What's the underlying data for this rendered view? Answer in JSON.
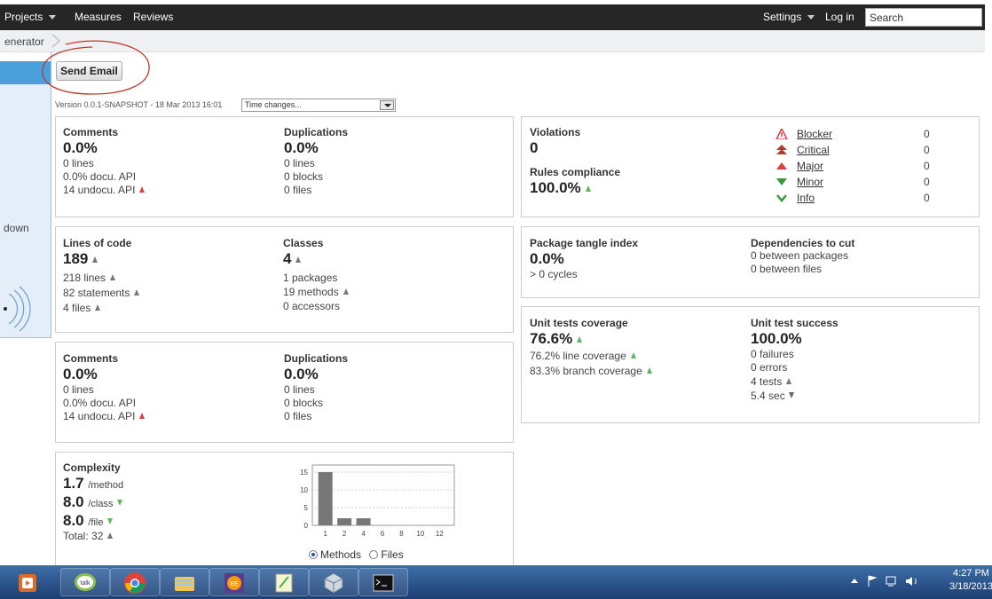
{
  "nav": {
    "projects": "Projects",
    "measures": "Measures",
    "reviews": "Reviews",
    "settings": "Settings",
    "login": "Log in",
    "search_value": "Search"
  },
  "breadcrumb": {
    "text": "enerator"
  },
  "sidebar": {
    "text": "down"
  },
  "toolbar": {
    "send_email": "Send Email",
    "version": "Version 0.0.1-SNAPSHOT - 18 Mar 2013 16:01",
    "time_changes": "Time changes..."
  },
  "comments1": {
    "label": "Comments",
    "value": "0.0%",
    "lines": "0 lines",
    "docu": "0.0% docu. API",
    "undocu": "14 undocu. API"
  },
  "duplications1": {
    "label": "Duplications",
    "value": "0.0%",
    "lines": "0 lines",
    "blocks": "0 blocks",
    "files": "0 files"
  },
  "violations": {
    "label": "Violations",
    "value": "0",
    "compliance_label": "Rules compliance",
    "compliance_value": "100.0%",
    "severities": [
      {
        "name": "Blocker",
        "count": "0"
      },
      {
        "name": "Critical",
        "count": "0"
      },
      {
        "name": "Major",
        "count": "0"
      },
      {
        "name": "Minor",
        "count": "0"
      },
      {
        "name": "Info",
        "count": "0"
      }
    ]
  },
  "size": {
    "loc_label": "Lines of code",
    "loc_value": "189",
    "lines": "218 lines",
    "statements": "82 statements",
    "files": "4 files",
    "classes_label": "Classes",
    "classes_value": "4",
    "packages": "1 packages",
    "methods": "19 methods",
    "accessors": "0 accessors"
  },
  "tangle": {
    "label": "Package tangle index",
    "value": "0.0%",
    "cycles": "> 0 cycles",
    "deps_label": "Dependencies to cut",
    "between_packages": "0 between packages",
    "between_files": "0 between files"
  },
  "comments2": {
    "label": "Comments",
    "value": "0.0%",
    "lines": "0 lines",
    "docu": "0.0% docu. API",
    "undocu": "14 undocu. API"
  },
  "duplications2": {
    "label": "Duplications",
    "value": "0.0%",
    "lines": "0 lines",
    "blocks": "0 blocks",
    "files": "0 files"
  },
  "tests": {
    "coverage_label": "Unit tests coverage",
    "coverage_value": "76.6%",
    "line_coverage": "76.2% line coverage",
    "branch_coverage": "83.3% branch coverage",
    "success_label": "Unit test success",
    "success_value": "100.0%",
    "failures": "0 failures",
    "errors": "0 errors",
    "tests": "4 tests",
    "duration": "5.4 sec"
  },
  "complexity": {
    "label": "Complexity",
    "per_method": "1.7",
    "per_method_unit": "/method",
    "per_class": "8.0",
    "per_class_unit": "/class",
    "per_file": "8.0",
    "per_file_unit": "/file",
    "total": "Total: 32",
    "radio_methods": "Methods",
    "radio_files": "Files"
  },
  "chart_data": {
    "type": "bar",
    "categories": [
      "1",
      "2",
      "4",
      "6",
      "8",
      "10",
      "12"
    ],
    "values": [
      15,
      2,
      2,
      0,
      0,
      0,
      0
    ],
    "ylim": [
      0,
      17
    ],
    "yticks": [
      "0",
      "5",
      "10",
      "15"
    ],
    "grid": true
  },
  "taskbar": {
    "time": "4:27 PM",
    "date": "3/18/2013"
  },
  "colors": {
    "nav_bg": "#262626",
    "accent_blue": "#4aa0dc",
    "up_red": "#d9413f",
    "up_green": "#5cb85c",
    "bar": "#777777"
  }
}
